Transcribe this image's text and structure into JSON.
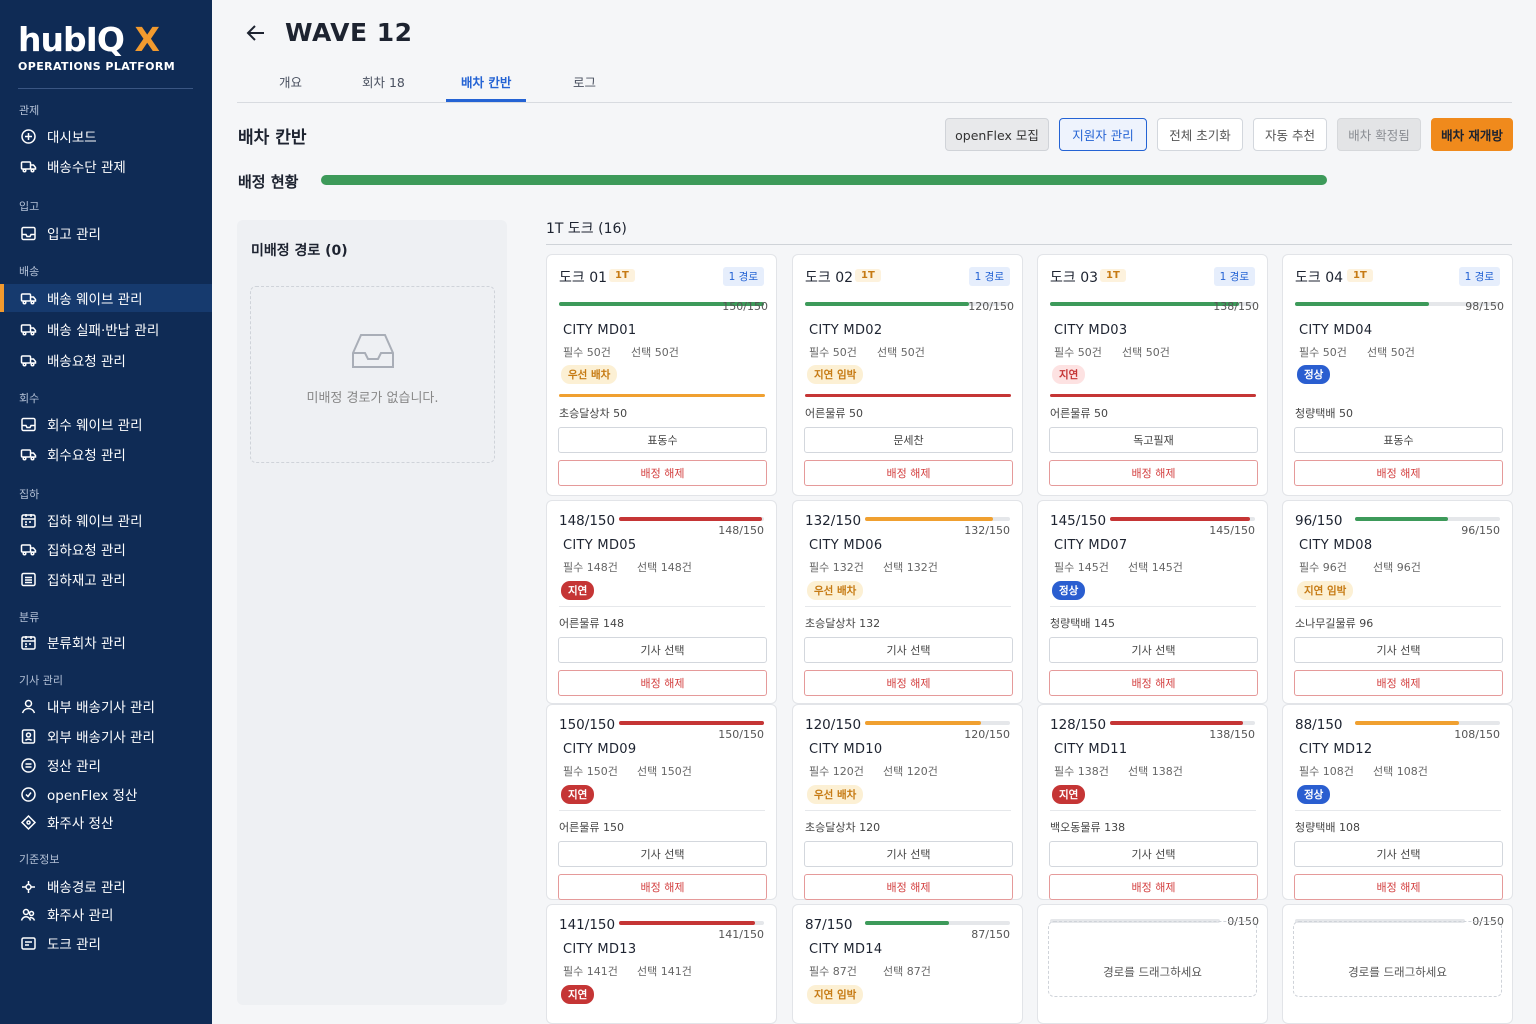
{
  "app": {
    "logo_main": "hubIQ",
    "logo_x": "X",
    "logo_sub": "OPERATIONS PLATFORM"
  },
  "sidebar": {
    "sections": [
      {
        "label": "관제",
        "items": [
          {
            "label": "대시보드",
            "icon": "plus-circle-icon"
          },
          {
            "label": "배송수단 관제",
            "icon": "truck-icon"
          }
        ]
      },
      {
        "label": "입고",
        "items": [
          {
            "label": "입고 관리",
            "icon": "inbox-icon"
          }
        ]
      },
      {
        "label": "배송",
        "items": [
          {
            "label": "배송 웨이브 관리",
            "icon": "truck-icon",
            "active": true
          },
          {
            "label": "배송 실패·반납 관리",
            "icon": "truck-icon"
          },
          {
            "label": "배송요청 관리",
            "icon": "truck-icon"
          }
        ]
      },
      {
        "label": "회수",
        "items": [
          {
            "label": "회수 웨이브 관리",
            "icon": "inbox-icon"
          },
          {
            "label": "회수요청 관리",
            "icon": "truck-icon"
          }
        ]
      },
      {
        "label": "집하",
        "items": [
          {
            "label": "집하 웨이브 관리",
            "icon": "calendar-icon"
          },
          {
            "label": "집하요청 관리",
            "icon": "truck-icon"
          },
          {
            "label": "집하재고 관리",
            "icon": "list-icon"
          }
        ]
      },
      {
        "label": "분류",
        "items": [
          {
            "label": "분류회차 관리",
            "icon": "calendar-icon"
          }
        ]
      },
      {
        "label": "기사 관리",
        "items": [
          {
            "label": "내부 배송기사 관리",
            "icon": "user-icon"
          },
          {
            "label": "외부 배송기사 관리",
            "icon": "id-card-icon"
          },
          {
            "label": "정산 관리",
            "icon": "coin-icon"
          },
          {
            "label": "openFlex 정산",
            "icon": "link-icon"
          },
          {
            "label": "화주사 정산",
            "icon": "diamond-icon"
          }
        ]
      },
      {
        "label": "기준정보",
        "items": [
          {
            "label": "배송경로 관리",
            "icon": "route-icon"
          },
          {
            "label": "화주사 관리",
            "icon": "users-icon"
          },
          {
            "label": "도크 관리",
            "icon": "dock-icon"
          }
        ]
      }
    ]
  },
  "header": {
    "title": "WAVE 12"
  },
  "tabs": [
    {
      "label": "개요"
    },
    {
      "label": "회차 18"
    },
    {
      "label": "배차 칸반",
      "active": true
    },
    {
      "label": "로그"
    }
  ],
  "page": {
    "heading": "배차 칸반"
  },
  "toolbar": [
    {
      "label": "openFlex 모집",
      "style": "grey"
    },
    {
      "label": "지원자 관리",
      "style": "blue-outline"
    },
    {
      "label": "전체 초기화",
      "style": "white"
    },
    {
      "label": "자동 추천",
      "style": "white"
    },
    {
      "label": "배차 확정됨",
      "style": "disabled"
    },
    {
      "label": "배차 재개방",
      "style": "orange"
    }
  ],
  "progress": {
    "label": "배정 현황",
    "fill_ratio": 1.0
  },
  "unassigned": {
    "title": "미배정 경로 (0)",
    "empty_text": "미배정 경로가 없습니다."
  },
  "group": {
    "title": "1T 도크 (16)"
  },
  "colors": {
    "green": "#3d9a5a",
    "orange": "#f0a030",
    "red": "#c53535",
    "blue": "#2463d4",
    "accent": "#f29a2e"
  },
  "docks": [
    {
      "name": "도크 01",
      "ton": "1T",
      "route": "1 경로",
      "cap": "150/150",
      "ratio": 1.0,
      "bar": "green",
      "city": "CITY MD01",
      "must": "필수 50건",
      "select": "선택 50건",
      "badge": "우선 배차",
      "badge_style": "orange",
      "line": "orange",
      "carrier": "초승달상차 50",
      "driver": "표동수",
      "release": "배정 해제"
    },
    {
      "name": "도크 02",
      "ton": "1T",
      "route": "1 경로",
      "cap": "120/150",
      "ratio": 0.8,
      "bar": "green",
      "city": "CITY MD02",
      "must": "필수 50건",
      "select": "선택 50건",
      "badge": "지연 임박",
      "badge_style": "orange",
      "line": "red",
      "carrier": "어른물류 50",
      "driver": "문세찬",
      "release": "배정 해제"
    },
    {
      "name": "도크 03",
      "ton": "1T",
      "route": "1 경로",
      "cap": "138/150",
      "ratio": 0.92,
      "bar": "green",
      "city": "CITY MD03",
      "must": "필수 50건",
      "select": "선택 50건",
      "badge": "지연",
      "badge_style": "pink",
      "line": "red",
      "carrier": "어른물류 50",
      "driver": "독고필재",
      "release": "배정 해제"
    },
    {
      "name": "도크 04",
      "ton": "1T",
      "route": "1 경로",
      "cap": "98/150",
      "ratio": 0.653,
      "bar": "green",
      "city": "CITY MD04",
      "must": "필수 50건",
      "select": "선택 50건",
      "badge": "정상",
      "badge_style": "blue",
      "line": "none",
      "carrier": "청량택배 50",
      "driver": "표동수",
      "release": "배정 해제"
    }
  ],
  "rows": [
    [
      {
        "head": "148/150",
        "cap": "148/150",
        "ratio": 0.987,
        "bar": "red",
        "city": "CITY MD05",
        "must": "필수 148건",
        "select": "선택 148건",
        "badge": "지연",
        "badge_style": "red",
        "carrier": "어른물류 148",
        "driver": "기사 선택",
        "release": "배정 해제"
      },
      {
        "head": "132/150",
        "cap": "132/150",
        "ratio": 0.88,
        "bar": "orange",
        "city": "CITY MD06",
        "must": "필수 132건",
        "select": "선택 132건",
        "badge": "우선 배차",
        "badge_style": "orange",
        "carrier": "초승달상차 132",
        "driver": "기사 선택",
        "release": "배정 해제"
      },
      {
        "head": "145/150",
        "cap": "145/150",
        "ratio": 0.967,
        "bar": "red",
        "city": "CITY MD07",
        "must": "필수 145건",
        "select": "선택 145건",
        "badge": "정상",
        "badge_style": "blue",
        "carrier": "청량택배 145",
        "driver": "기사 선택",
        "release": "배정 해제"
      },
      {
        "head": "96/150",
        "cap": "96/150",
        "ratio": 0.64,
        "bar": "green",
        "city": "CITY MD08",
        "must": "필수 96건",
        "select": "선택 96건",
        "badge": "지연 임박",
        "badge_style": "orange",
        "carrier": "소나무길물류 96",
        "driver": "기사 선택",
        "release": "배정 해제"
      }
    ],
    [
      {
        "head": "150/150",
        "cap": "150/150",
        "ratio": 1.0,
        "bar": "red",
        "city": "CITY MD09",
        "must": "필수 150건",
        "select": "선택 150건",
        "badge": "지연",
        "badge_style": "red",
        "carrier": "어른물류 150",
        "driver": "기사 선택",
        "release": "배정 해제"
      },
      {
        "head": "120/150",
        "cap": "120/150",
        "ratio": 0.8,
        "bar": "orange",
        "city": "CITY MD10",
        "must": "필수 120건",
        "select": "선택 120건",
        "badge": "우선 배차",
        "badge_style": "orange",
        "carrier": "초승달상차 120",
        "driver": "기사 선택",
        "release": "배정 해제"
      },
      {
        "head": "128/150",
        "cap": "138/150",
        "ratio": 0.92,
        "bar": "red",
        "city": "CITY MD11",
        "must": "필수 138건",
        "select": "선택 138건",
        "badge": "지연",
        "badge_style": "red",
        "carrier": "백오동물류 138",
        "driver": "기사 선택",
        "release": "배정 해제"
      },
      {
        "head": "88/150",
        "cap": "108/150",
        "ratio": 0.72,
        "bar": "orange",
        "city": "CITY MD12",
        "must": "필수 108건",
        "select": "선택 108건",
        "badge": "정상",
        "badge_style": "blue",
        "carrier": "청량택배 108",
        "driver": "기사 선택",
        "release": "배정 해제"
      }
    ],
    [
      {
        "head": "141/150",
        "cap": "141/150",
        "ratio": 0.94,
        "bar": "red",
        "city": "CITY MD13",
        "must": "필수 141건",
        "select": "선택 141건",
        "badge": "지연",
        "badge_style": "red"
      },
      {
        "head": "87/150",
        "cap": "87/150",
        "ratio": 0.58,
        "bar": "green",
        "city": "CITY MD14",
        "must": "필수 87건",
        "select": "선택 87건",
        "badge": "지연 임박",
        "badge_style": "orange"
      },
      {
        "drop": true,
        "cap": "0/150",
        "ratio": 0,
        "drop_text": "경로를 드래그하세요"
      },
      {
        "drop": true,
        "cap": "0/150",
        "ratio": 0,
        "drop_text": "경로를 드래그하세요"
      }
    ]
  ]
}
